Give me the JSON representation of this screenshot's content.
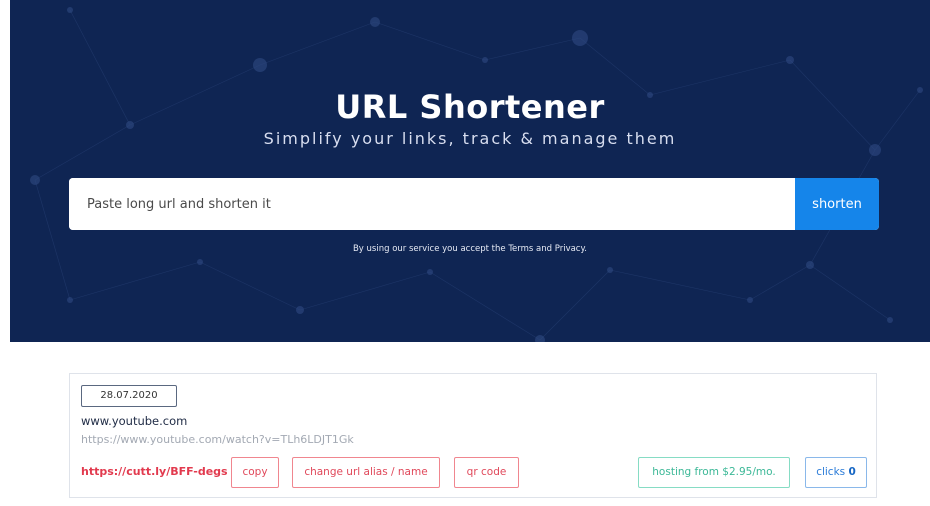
{
  "hero": {
    "title": "URL Shortener",
    "subtitle": "Simplify your links, track & manage them",
    "background_color": "#0f2553",
    "search": {
      "placeholder": "Paste long url and shorten it",
      "value": "",
      "button_label": "shorten"
    },
    "terms_text": "By using our service you accept the Terms and Privacy."
  },
  "link_card": {
    "date": "28.07.2020",
    "domain": "www.youtube.com",
    "long_url": "https://www.youtube.com/watch?v=TLh6LDJT1Gk",
    "short_url": "https://cutt.ly/BFF-degs",
    "actions": {
      "copy": "copy",
      "change_alias": "change url alias / name",
      "qr_code": "qr code"
    },
    "hosting_label": "hosting from $2.95/mo.",
    "clicks_label": "clicks",
    "clicks_count": "0"
  },
  "colors": {
    "accent_blue": "#1585ea",
    "danger_red": "#e23a4e",
    "success_green": "#3cb897"
  }
}
